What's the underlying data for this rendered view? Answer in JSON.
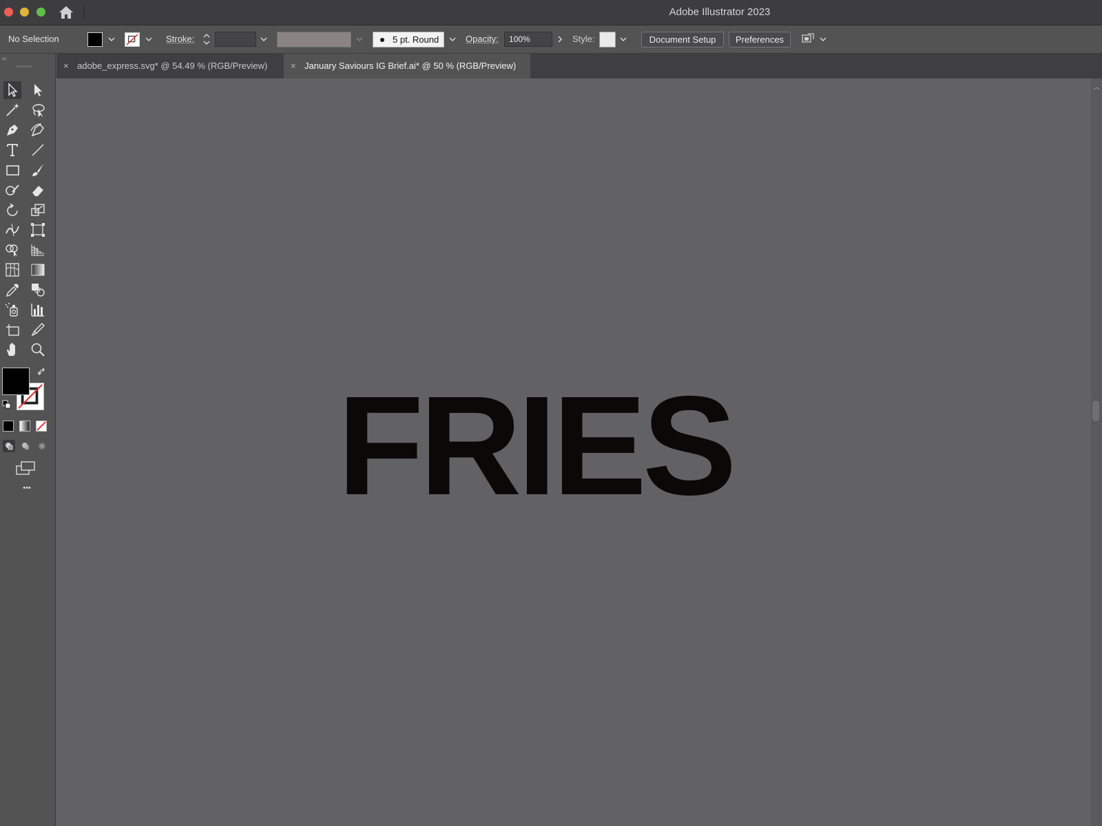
{
  "app": {
    "title": "Adobe Illustrator 2023"
  },
  "control_bar": {
    "selection_status": "No Selection",
    "stroke_label": "Stroke:",
    "brush_label": "5 pt. Round",
    "opacity_label": "Opacity:",
    "opacity_value": "100%",
    "style_label": "Style:",
    "document_setup_label": "Document Setup",
    "preferences_label": "Preferences"
  },
  "tabs": [
    {
      "label": "adobe_express.svg* @ 54.49 % (RGB/Preview)",
      "close": "×",
      "active": false
    },
    {
      "label": "January Saviours IG Brief.ai* @ 50 % (RGB/Preview)",
      "close": "×",
      "active": true
    }
  ],
  "toolbox": {
    "collapse": "‹‹",
    "more": "•••"
  },
  "canvas": {
    "artwork_text": "FRIES"
  },
  "colors": {
    "fill": "#000000",
    "stroke": "none",
    "artwork": "#0b0808"
  }
}
